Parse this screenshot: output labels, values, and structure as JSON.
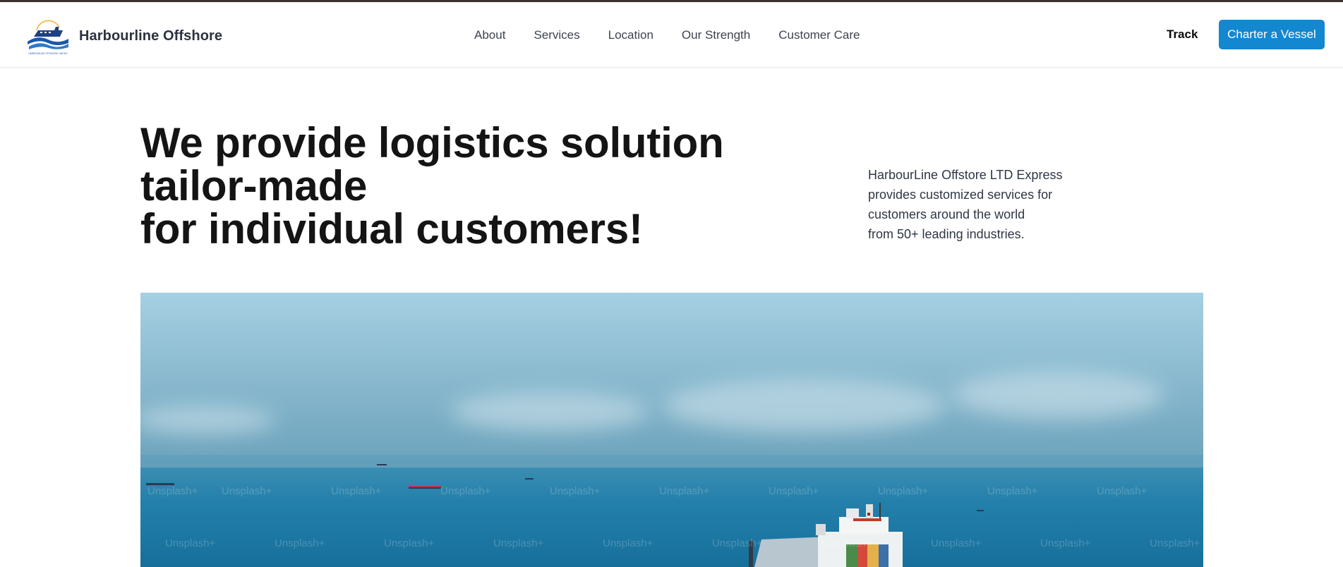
{
  "brand": {
    "name": "Harbourline Offshore",
    "logo_icon": "ship-waves-logo-icon",
    "logo_caption": "HARBOURLINE OFFSHORE LIMITED"
  },
  "nav": {
    "links": [
      "About",
      "Services",
      "Location",
      "Our Strength",
      "Customer Care"
    ],
    "track_label": "Track",
    "cta_label": "Charter a Vessel"
  },
  "hero": {
    "heading_lines": [
      "We provide logistics solution",
      "tailor-made",
      "for individual customers!"
    ],
    "description_lines": [
      "HarbourLine Offstore LTD Express",
      "provides customized services for",
      "customers around the world",
      "from 50+ leading industries."
    ],
    "image_subject": "aerial-view-cargo-ship-at-sea",
    "image_watermark": "Unsplash+"
  },
  "colors": {
    "accent": "#1387d0",
    "heading": "#141414",
    "body_text": "#2f3645",
    "sea": "#1f7fa8",
    "sky": "#a3cde0"
  }
}
